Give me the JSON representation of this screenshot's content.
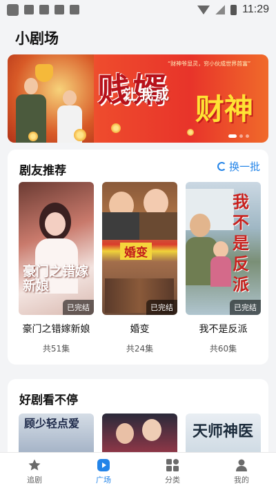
{
  "status_bar": {
    "time": "11:29"
  },
  "page_title": "小剧场",
  "banner": {
    "slogan": "“财神爷显灵，穷小伙成世界首富”",
    "main_text": "贱婿",
    "sub_text": "让我成",
    "highlight_text": "财神",
    "slide_count": 3,
    "active_slide": 1
  },
  "section_recommend": {
    "title": "剧友推荐",
    "refresh_label": "换一批",
    "items": [
      {
        "title": "豪门之错嫁新娘",
        "episodes": "共51集",
        "badge": "已完结",
        "poster_text": "豪门之错嫁新娘"
      },
      {
        "title": "婚变",
        "episodes": "共24集",
        "badge": "已完结",
        "poster_text": "婚变"
      },
      {
        "title": "我不是反派",
        "episodes": "共60集",
        "badge": "已完结",
        "poster_text": "我不是反派"
      }
    ]
  },
  "section_nonstop": {
    "title": "好剧看不停",
    "posters": [
      "顾少轻点爱",
      "",
      "天师神医"
    ]
  },
  "bottom_nav": [
    {
      "label": "追剧",
      "icon": "star-icon"
    },
    {
      "label": "广场",
      "icon": "play-icon"
    },
    {
      "label": "分类",
      "icon": "category-icon"
    },
    {
      "label": "我的",
      "icon": "person-icon"
    }
  ],
  "colors": {
    "accent": "#2384e8"
  }
}
